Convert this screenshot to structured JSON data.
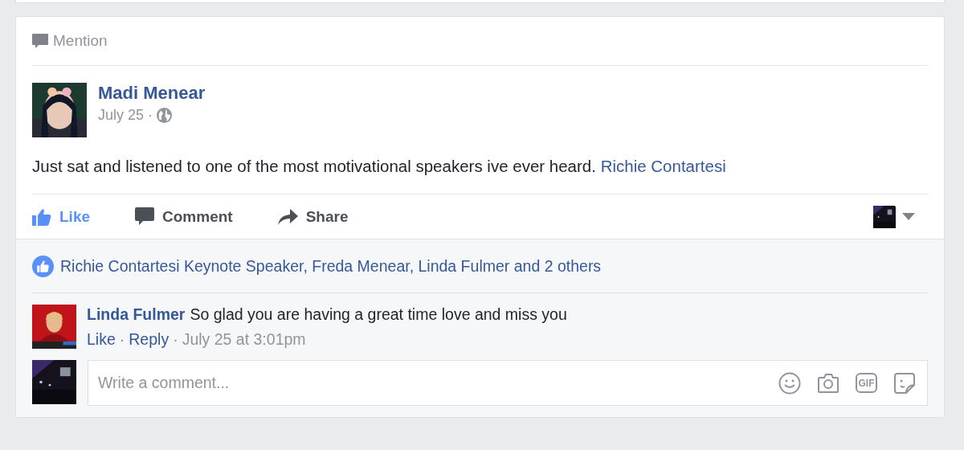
{
  "story_type": "Mention",
  "post": {
    "author": "Madi Menear",
    "date": "July 25",
    "separator": "·",
    "public": true,
    "text": "Just sat and listened to one of the most motivational speakers ive ever heard.",
    "mention": "Richie Contartesi"
  },
  "actions": [
    {
      "kind": "like",
      "label": "Like",
      "selected": true
    },
    {
      "kind": "comment",
      "label": "Comment",
      "selected": false
    },
    {
      "kind": "share",
      "label": "Share",
      "selected": false
    }
  ],
  "likes_summary": "Richie Contartesi Keynote Speaker, Freda Menear, Linda Fulmer and 2 others",
  "comments": [
    {
      "author": "Linda Fulmer",
      "text": "So glad you are having a great time love and miss you",
      "like": "Like",
      "reply": "Reply",
      "time": "July 25 at 3:01pm"
    }
  ],
  "composer": {
    "placeholder": "Write a comment...",
    "gif_label": "GIF"
  }
}
